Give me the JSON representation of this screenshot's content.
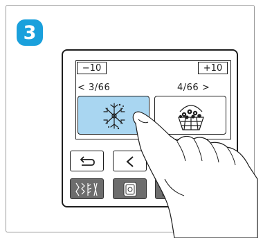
{
  "step": {
    "number": "3"
  },
  "selector": {
    "minus_label": "−10",
    "plus_label": "+10",
    "prev_page": "< 3/66",
    "next_page": "4/66 >"
  },
  "patterns": [
    {
      "name": "snowflake-pattern",
      "selected": true
    },
    {
      "name": "flower-basket-pattern",
      "selected": false
    }
  ],
  "colors": {
    "badge": "#1aa0dc",
    "selected_tile": "#a9d6f1",
    "tool_button": "#6d6d6d"
  },
  "nav_buttons": [
    "back-arrow-icon",
    "left-chevron-icon"
  ],
  "tool_buttons": [
    "stitch-pattern-icon",
    "embroidery-hoop-icon"
  ]
}
